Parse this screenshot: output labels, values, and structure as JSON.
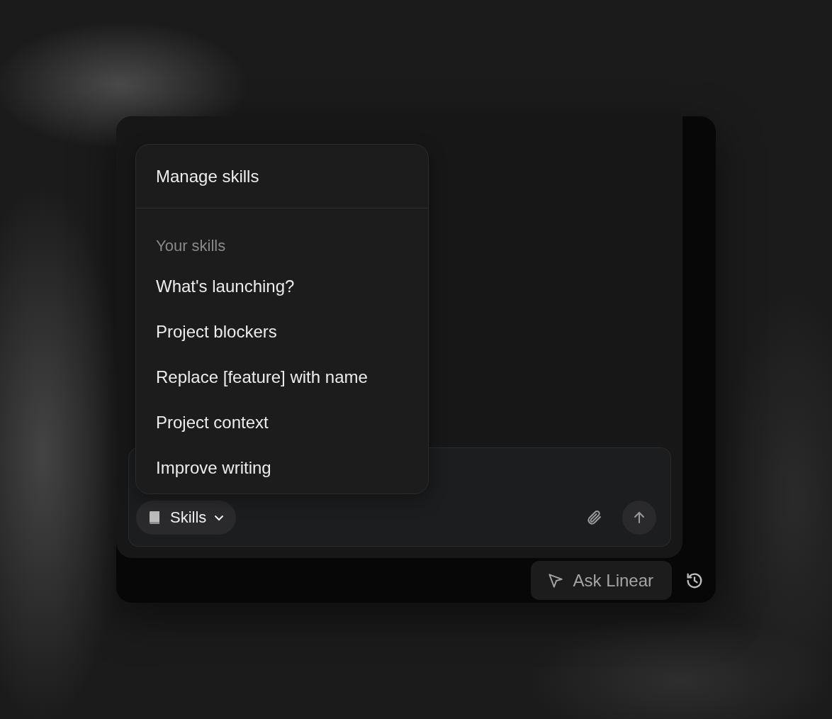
{
  "menu": {
    "header_item": "Manage skills",
    "section_label": "Your skills",
    "items": [
      {
        "label": "What's launching?"
      },
      {
        "label": "Project blockers"
      },
      {
        "label": "Replace [feature] with name"
      },
      {
        "label": "Project context"
      },
      {
        "label": "Improve writing"
      }
    ]
  },
  "composer": {
    "skills_button": "Skills"
  },
  "bottom_bar": {
    "ask_button": "Ask Linear"
  }
}
